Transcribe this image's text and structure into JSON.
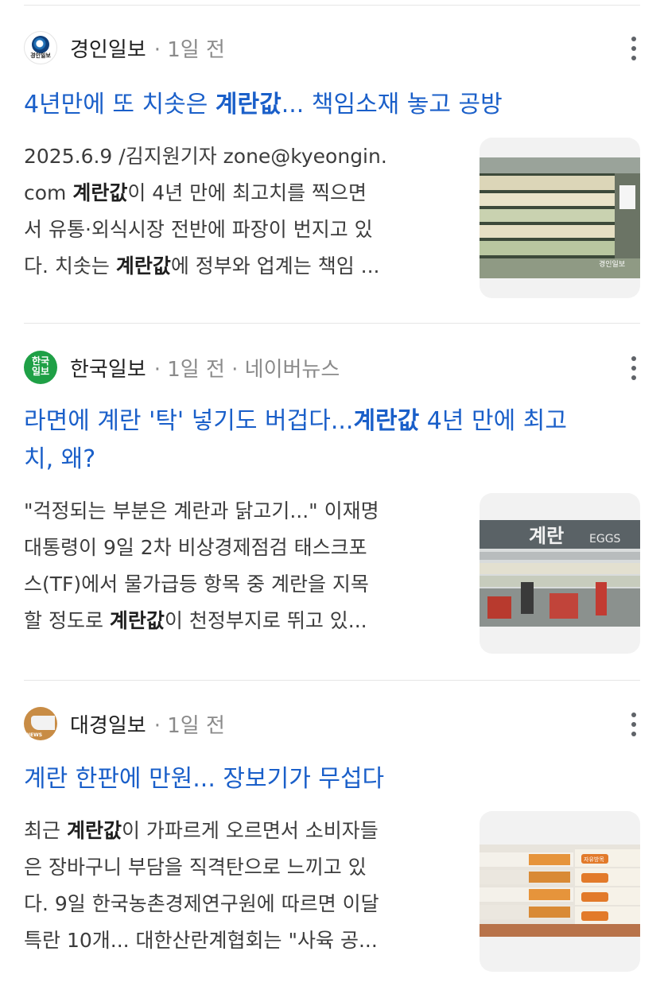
{
  "articles": [
    {
      "source": "경인일보",
      "meta": "· 1일 전",
      "logo_text": "경인일보",
      "title": {
        "pre": "4년만에 또 치솟은 ",
        "bold": "계란값",
        "post": "... 책임소재 놓고 공방"
      },
      "snippet": {
        "l1": "2025.6.9 /김지원기자 zone@kyeongin.",
        "l2_pre": "com ",
        "l2_bold": "계란값",
        "l2_post": "이 4년 만에 최고치를 찍으면",
        "l3": "서 유통·외식시장 전반에 파장이 번지고 있",
        "l4_pre": "다. 치솟는 ",
        "l4_bold": "계란값",
        "l4_post": "에 정부와 업계는 책임 ..."
      },
      "watermark": "경인일보"
    },
    {
      "source": "한국일보",
      "meta": "· 1일 전 · 네이버뉴스",
      "logo_text_1": "한국",
      "logo_text_2": "일보",
      "title": {
        "pre": "라면에 계란 '탁' 넣기도 버겁다...",
        "bold": "계란값",
        "post": " 4년 만에 최고",
        "line2": "치, 왜?"
      },
      "snippet": {
        "l1": "\"걱정되는 부분은 계란과 닭고기...\" 이재명",
        "l2": "대통령이 9일 2차 비상경제점검 태스크포",
        "l3": "스(TF)에서 물가급등 항목 중 계란을 지목",
        "l4_pre": "할 정도로 ",
        "l4_bold": "계란값",
        "l4_post": "이 천정부지로 뛰고 있..."
      },
      "sign_ko": "계란",
      "sign_en": "EGGS"
    },
    {
      "source": "대경일보",
      "meta": "· 1일 전",
      "logo_text": "NEWS",
      "title": {
        "text": "계란 한판에 만원... 장보기가 무섭다"
      },
      "snippet": {
        "l1_pre": "최근 ",
        "l1_bold": "계란값",
        "l1_post": "이 가파르게 오르면서 소비자들",
        "l2": "은 장바구니 부담을 직격탄으로 느끼고 있",
        "l3": "다. 9일 한국농촌경제연구원에 따르면 이달",
        "l4": "특란 10개... 대한산란계협회는 \"사육 공..."
      },
      "carton_label": "자유방목"
    }
  ],
  "colors": {
    "title": "#1a5fc9",
    "meta": "#8a8a8a",
    "divider": "#e6e6e6"
  }
}
